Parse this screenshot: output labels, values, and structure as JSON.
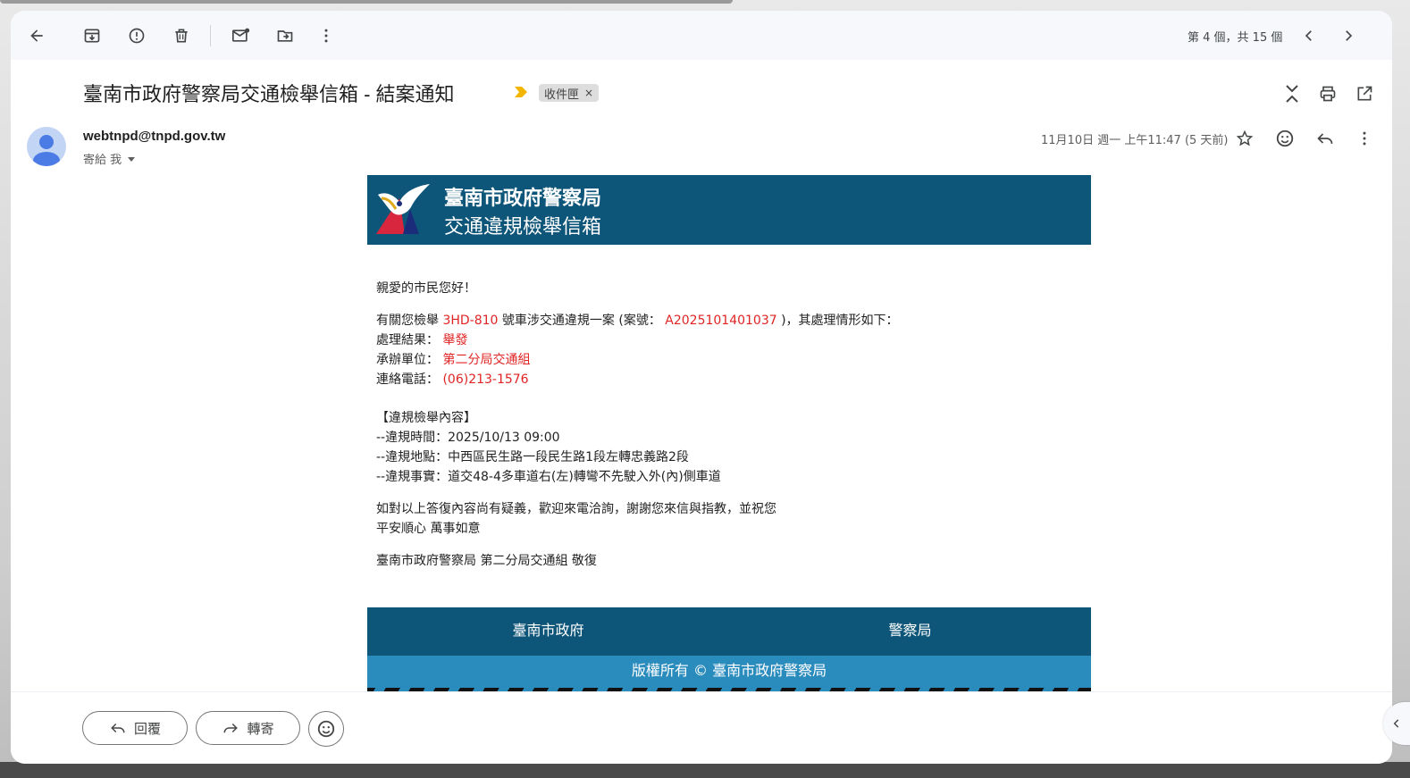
{
  "toolbar": {
    "pager": "第 4 個，共 15 個"
  },
  "subject": {
    "title": "臺南市政府警察局交通檢舉信箱 - 結案通知",
    "label": "收件匣",
    "label_close": "×"
  },
  "header": {
    "sender": "webtnpd@tnpd.gov.tw",
    "to": "寄給 我",
    "date": "11月10日 週一 上午11:47 (5 天前)"
  },
  "email": {
    "banner_title": "臺南市政府警察局",
    "banner_subtitle": "交通違規檢舉信箱",
    "greeting": "親愛的市民您好！",
    "intro_pre": "有關您檢舉 ",
    "plate": "3HD-810",
    "intro_mid": " 號車涉交通違規一案 (案號： ",
    "case_no": "A2025101401037",
    "intro_post": " )，其處理情形如下：",
    "result_label": "處理結果： ",
    "result_value": "舉發",
    "unit_label": "承辦單位： ",
    "unit_value": "第二分局交通組",
    "phone_label": "連絡電話： ",
    "phone_value": "(06)213-1576",
    "section_title": "【違規檢舉內容】",
    "detail_time": "--違規時間：2025/10/13 09:00",
    "detail_place": "--違規地點：中西區民生路一段民生路1段左轉忠義路2段",
    "detail_fact": "--違規事實：道交48-4多車道右(左)轉彎不先駛入外(內)側車道",
    "closing_1": "如對以上答復內容尚有疑義，歡迎來電洽詢，謝謝您來信與指教，並祝您",
    "closing_2": "平安順心 萬事如意",
    "signature": "臺南市政府警察局 第二分局交通組 敬復",
    "footer_left": "臺南市政府",
    "footer_right": "警察局",
    "copyright": "版權所有 © 臺南市政府警察局"
  },
  "actions": {
    "reply": "回覆",
    "forward": "轉寄"
  },
  "colors": {
    "banner": "#0e5679",
    "footer_band": "#2a8bbd",
    "highlight": "#e02424",
    "important_marker": "#f2b600"
  }
}
